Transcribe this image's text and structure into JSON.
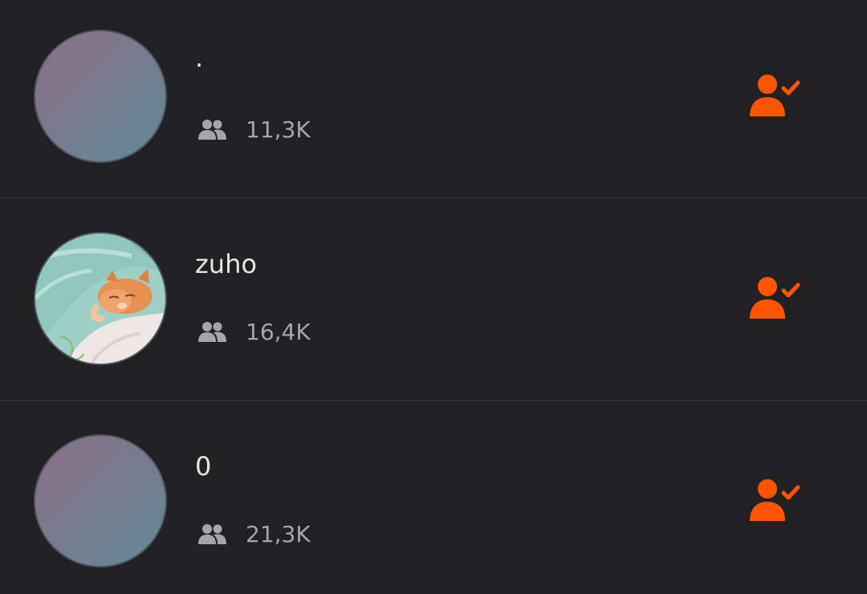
{
  "colors": {
    "background": "#212023",
    "divider": "#2e2d31",
    "name_text": "#e6e6e6",
    "count_text": "#a6a6a9",
    "accent": "#ff5500"
  },
  "users": [
    {
      "name": "·",
      "followers": "11,3K",
      "avatar": "placeholder-gradient",
      "stat_icon": "followers-icon",
      "action_icon": "user-following-check-icon"
    },
    {
      "name": "zuho",
      "followers": "16,4K",
      "avatar": "photo-sleeping-kitten-under-blanket",
      "stat_icon": "followers-icon",
      "action_icon": "user-following-check-icon"
    },
    {
      "name": "0",
      "followers": "21,3K",
      "avatar": "placeholder-gradient",
      "stat_icon": "followers-icon",
      "action_icon": "user-following-check-icon"
    }
  ]
}
